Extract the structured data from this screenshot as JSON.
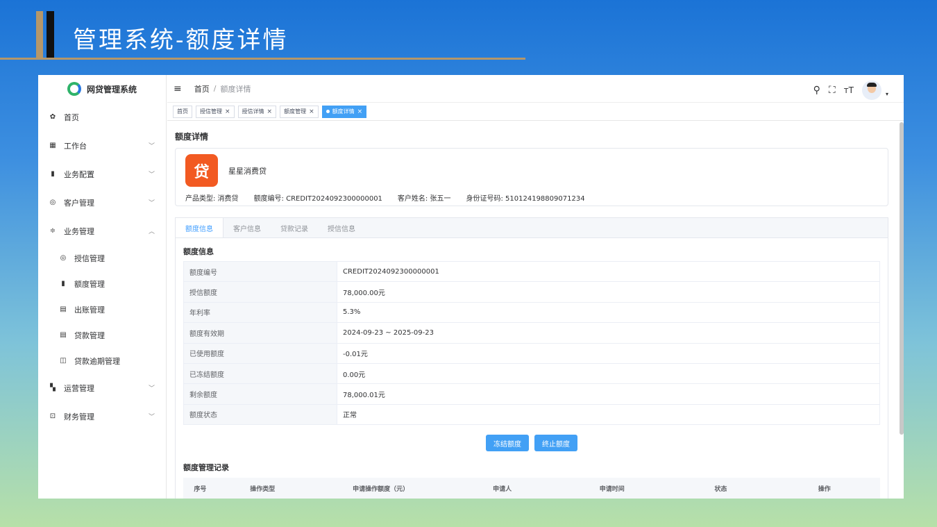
{
  "slide": {
    "title": "管理系统-额度详情"
  },
  "sidebar": {
    "brand": "网贷管理系统",
    "items": [
      {
        "label": "首页",
        "icon": "dashboard-icon",
        "glyph": "✿"
      },
      {
        "label": "工作台",
        "icon": "grid-icon",
        "glyph": "▦",
        "chevron": "﹀"
      },
      {
        "label": "业务配置",
        "icon": "book-icon",
        "glyph": "▮",
        "chevron": "﹀"
      },
      {
        "label": "客户管理",
        "icon": "lifebuoy-icon",
        "glyph": "◎",
        "chevron": "﹀"
      },
      {
        "label": "业务管理",
        "icon": "sliders-icon",
        "glyph": "≑",
        "chevron": "︿"
      }
    ],
    "subitems": [
      {
        "label": "授信管理",
        "icon": "lifebuoy-icon",
        "glyph": "◎"
      },
      {
        "label": "额度管理",
        "icon": "book-icon",
        "glyph": "▮"
      },
      {
        "label": "出账管理",
        "icon": "document-icon",
        "glyph": "▤"
      },
      {
        "label": "贷款管理",
        "icon": "document-icon",
        "glyph": "▤"
      },
      {
        "label": "贷款逾期管理",
        "icon": "open-book-icon",
        "glyph": "◫"
      }
    ],
    "items_after": [
      {
        "label": "运营管理",
        "icon": "copy-icon",
        "glyph": "▚",
        "chevron": "﹀"
      },
      {
        "label": "财务管理",
        "icon": "monitor-icon",
        "glyph": "⊡",
        "chevron": "﹀"
      }
    ]
  },
  "navbar": {
    "breadcrumb_home": "首页",
    "breadcrumb_sep": "/",
    "breadcrumb_current": "额度详情",
    "icons": {
      "menu": "≡",
      "search": "⚲",
      "fullscreen": "⛶",
      "font_size": "тT",
      "caret": "▾"
    }
  },
  "tags": [
    {
      "label": "首页",
      "closable": false
    },
    {
      "label": "授信管理",
      "closable": true
    },
    {
      "label": "授信详情",
      "closable": true
    },
    {
      "label": "额度管理",
      "closable": true
    },
    {
      "label": "额度详情",
      "closable": true,
      "active": true
    }
  ],
  "page": {
    "title": "额度详情",
    "product": {
      "icon_text": "贷",
      "name": "星星消费贷",
      "meta": [
        "产品类型: 消费贷",
        "额度编号: CREDIT2024092300000001",
        "客户姓名: 张五一",
        "身份证号码: 510124198809071234"
      ]
    },
    "tabs": [
      "额度信息",
      "客户信息",
      "贷款记录",
      "授信信息"
    ],
    "section_title": "额度信息",
    "details": [
      {
        "label": "额度编号",
        "value": "CREDIT2024092300000001"
      },
      {
        "label": "授信额度",
        "value": "78,000.00元"
      },
      {
        "label": "年利率",
        "value": "5.3%"
      },
      {
        "label": "额度有效期",
        "value": "2024-09-23 ~ 2025-09-23"
      },
      {
        "label": "已使用额度",
        "value": "-0.01元"
      },
      {
        "label": "已冻结额度",
        "value": "0.00元"
      },
      {
        "label": "剩余额度",
        "value": "78,000.01元"
      },
      {
        "label": "额度状态",
        "value": "正常"
      }
    ],
    "buttons": {
      "freeze": "冻结额度",
      "terminate": "终止额度"
    },
    "records": {
      "title": "额度管理记录",
      "columns": [
        "序号",
        "操作类型",
        "申请操作额度（元）",
        "申请人",
        "申请时间",
        "状态",
        "操作"
      ]
    }
  },
  "colors": {
    "accent": "#42a0f5",
    "product_icon": "#f25a22",
    "slide_gold": "#b5976a"
  }
}
